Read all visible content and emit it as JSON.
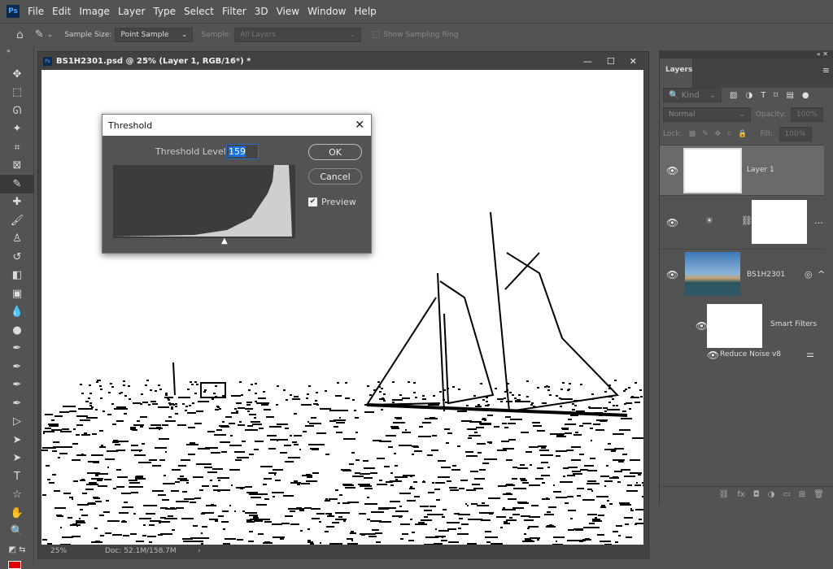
{
  "menubar": {
    "logo": "Ps",
    "items": [
      "File",
      "Edit",
      "Image",
      "Layer",
      "Type",
      "Select",
      "Filter",
      "3D",
      "View",
      "Window",
      "Help"
    ]
  },
  "options": {
    "sample_size_label": "Sample Size:",
    "sample_size_value": "Point Sample",
    "sample_label": "Sample:",
    "sample_value": "All Layers",
    "sampling_ring_label": "Show Sampling Ring"
  },
  "document": {
    "title": "BS1H2301.psd @ 25% (Layer 1, RGB/16*) *",
    "zoom": "25%",
    "doc_info": "Doc: 52.1M/158.7M"
  },
  "dialog": {
    "title": "Threshold",
    "level_label": "Threshold Level:",
    "level_value": "159",
    "ok": "OK",
    "cancel": "Cancel",
    "preview_label": "Preview",
    "preview_checked": true
  },
  "layers_panel": {
    "tab": "Layers",
    "filter_placeholder": "Kind",
    "blend_mode": "Normal",
    "opacity_label": "Opacity:",
    "opacity_value": "100%",
    "lock_label": "Lock:",
    "fill_label": "Fill:",
    "fill_value": "100%",
    "layers": [
      {
        "name": "Layer 1",
        "selected": true
      },
      {
        "name": "",
        "type": "adjustment"
      },
      {
        "name": "BS1H2301",
        "type": "smart-object"
      }
    ],
    "smart_filters_label": "Smart Filters",
    "filter_name": "Reduce Noise v8"
  },
  "colors": {
    "foreground": "#e00000",
    "accent": "#1473e6"
  }
}
